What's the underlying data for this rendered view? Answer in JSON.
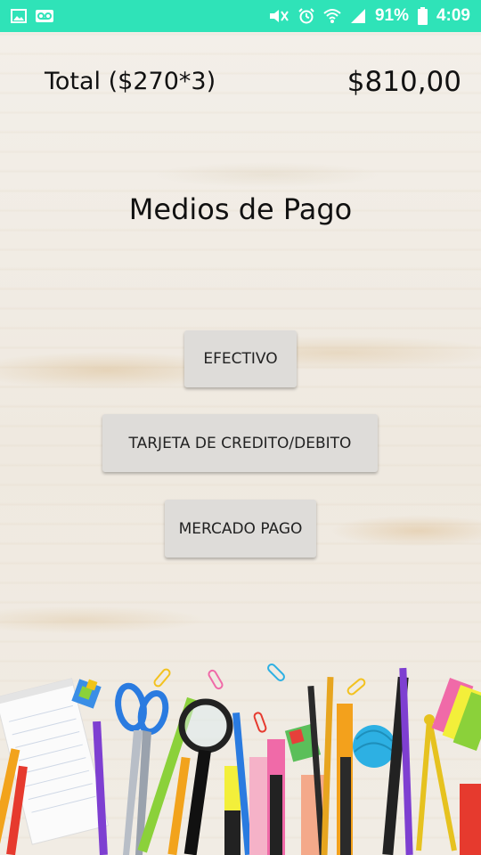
{
  "status_bar": {
    "battery_percent": "91%",
    "time": "4:09",
    "background_color": "#2fe3b8",
    "left_icons": [
      "image-icon",
      "voicemail-icon"
    ],
    "right_icons": [
      "mute-icon",
      "alarm-icon",
      "wifi-icon",
      "signal-icon",
      "battery-icon"
    ]
  },
  "summary": {
    "total_label": "Total ($270*3)",
    "total_amount": "$810,00"
  },
  "payment": {
    "title": "Medios de Pago",
    "cash_label": "EFECTIVO",
    "card_label": "TARJETA DE CREDITO/DEBITO",
    "mercadopago_label": "MERCADO PAGO"
  },
  "background": {
    "description_icon": "school-supplies-illustration"
  }
}
